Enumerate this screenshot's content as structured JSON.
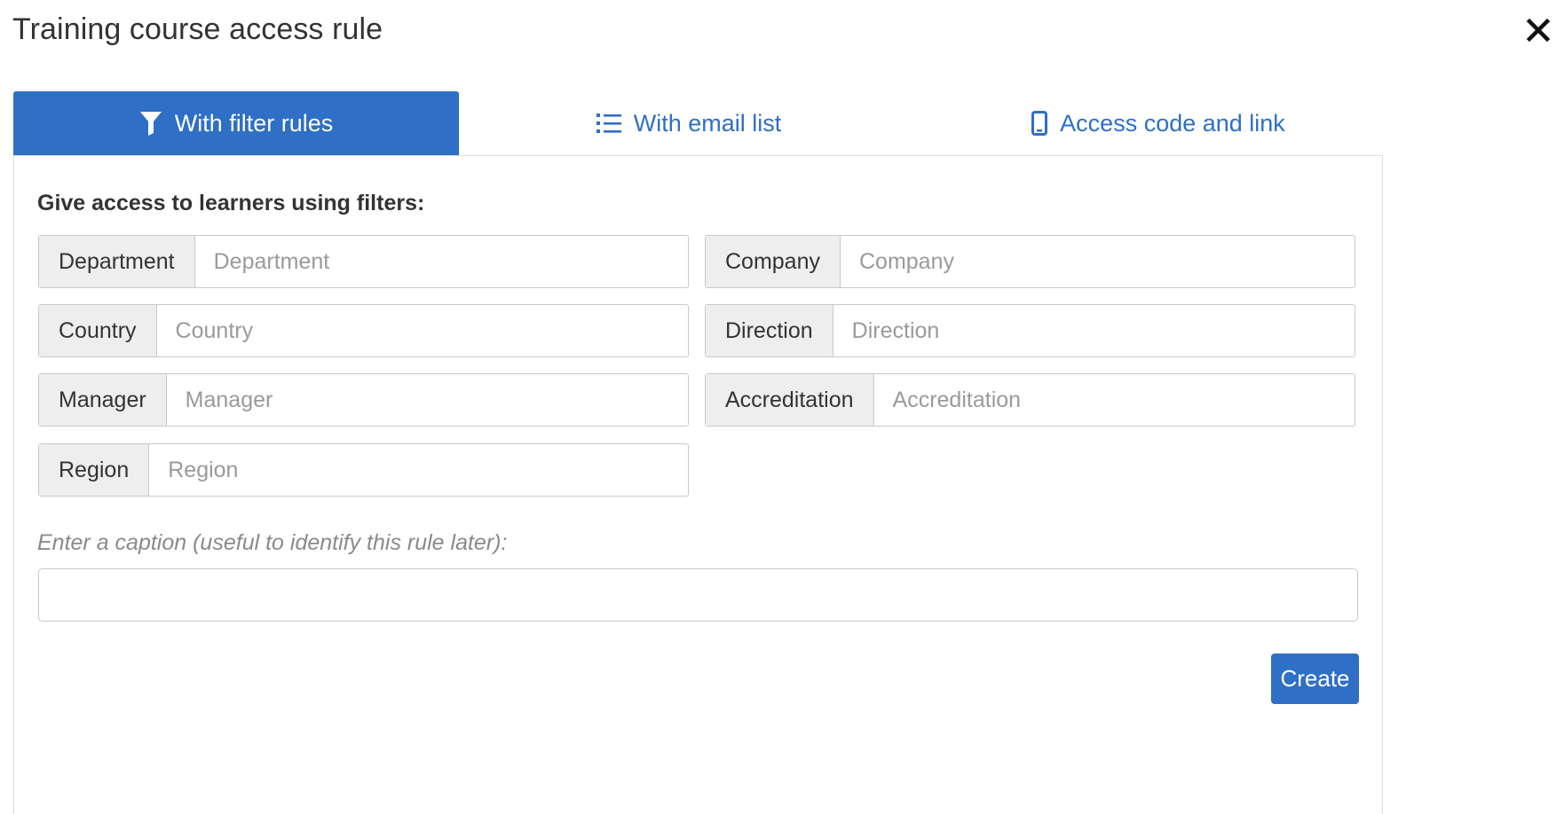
{
  "dialog": {
    "title": "Training course access rule",
    "close_icon": "close-icon"
  },
  "tabs": [
    {
      "label": "With filter rules",
      "icon": "filter-icon",
      "active": true
    },
    {
      "label": "With email list",
      "icon": "list-icon",
      "active": false
    },
    {
      "label": "Access code and link",
      "icon": "mobile-icon",
      "active": false
    }
  ],
  "filters": {
    "heading": "Give access to learners using filters:",
    "department": {
      "label": "Department",
      "placeholder": "Department",
      "value": ""
    },
    "company": {
      "label": "Company",
      "placeholder": "Company",
      "value": ""
    },
    "country": {
      "label": "Country",
      "placeholder": "Country",
      "value": ""
    },
    "direction": {
      "label": "Direction",
      "placeholder": "Direction",
      "value": ""
    },
    "manager": {
      "label": "Manager",
      "placeholder": "Manager",
      "value": ""
    },
    "accreditation": {
      "label": "Accreditation",
      "placeholder": "Accreditation",
      "value": ""
    },
    "region": {
      "label": "Region",
      "placeholder": "Region",
      "value": ""
    }
  },
  "caption": {
    "label": "Enter a caption (useful to identify this rule later):",
    "value": ""
  },
  "actions": {
    "create_label": "Create"
  },
  "colors": {
    "accent": "#2f6fc6",
    "addon_bg": "#eeeeee",
    "border": "#c9c9c9"
  }
}
